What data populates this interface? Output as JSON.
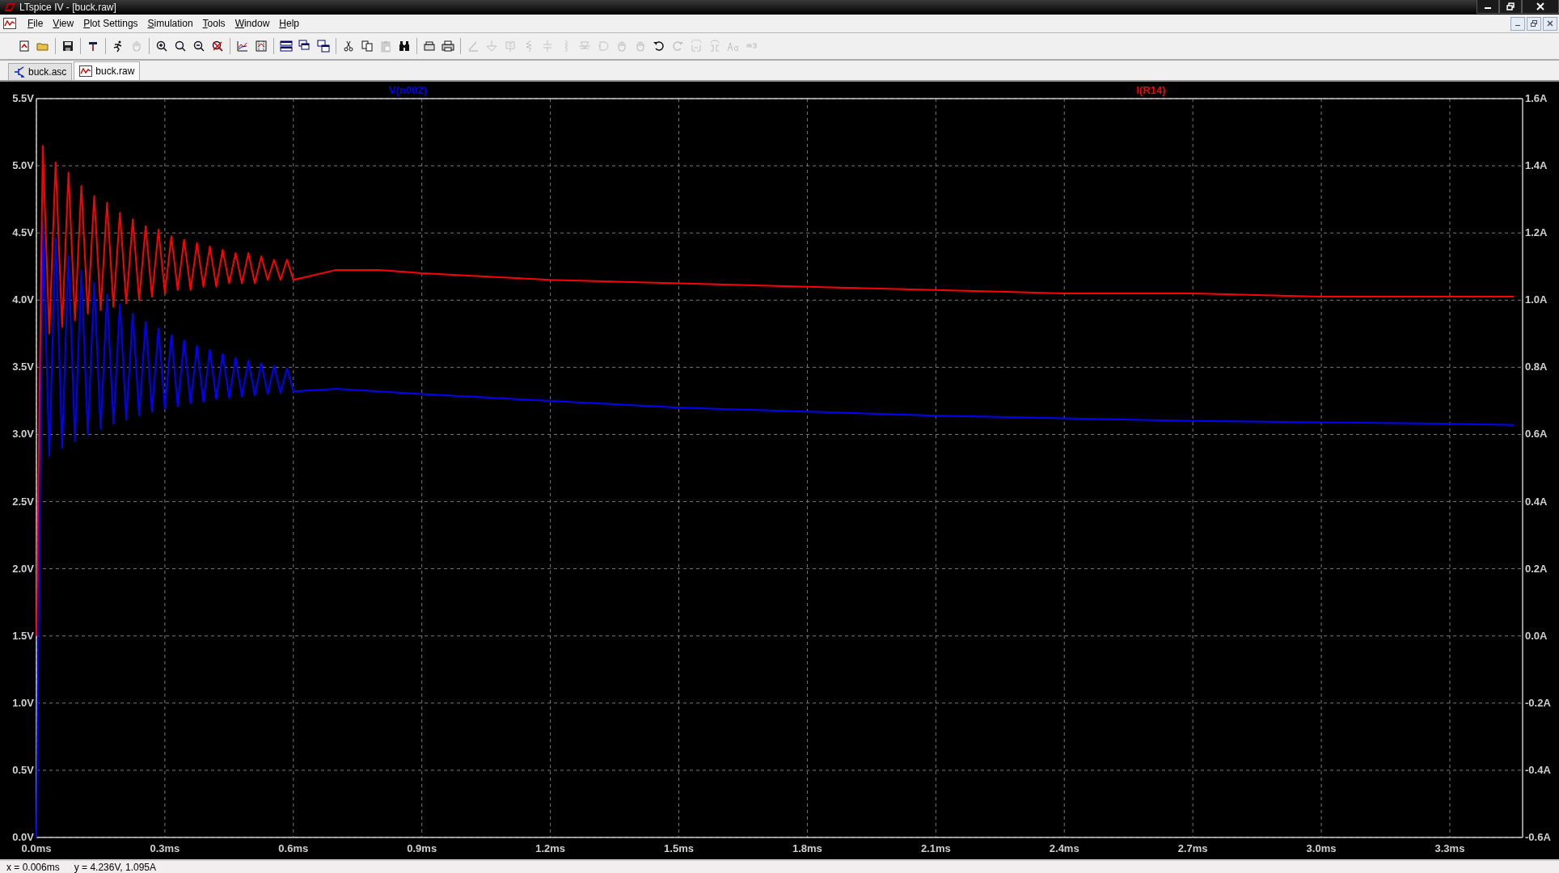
{
  "window": {
    "title": "LTspice IV - [buck.raw]"
  },
  "menu": [
    "File",
    "View",
    "Plot Settings",
    "Simulation",
    "Tools",
    "Window",
    "Help"
  ],
  "toolbar": [
    {
      "kind": "new-document",
      "disabled": false
    },
    {
      "kind": "open-folder",
      "disabled": false
    },
    {
      "kind": "separator"
    },
    {
      "kind": "floppy-save",
      "disabled": false
    },
    {
      "kind": "separator"
    },
    {
      "kind": "hammer",
      "disabled": false
    },
    {
      "kind": "separator"
    },
    {
      "kind": "running-man",
      "disabled": false
    },
    {
      "kind": "hand",
      "disabled": true
    },
    {
      "kind": "separator"
    },
    {
      "kind": "zoom-in",
      "disabled": false
    },
    {
      "kind": "magnifier",
      "disabled": false
    },
    {
      "kind": "zoom-out",
      "disabled": false
    },
    {
      "kind": "zoom-cancel",
      "disabled": false
    },
    {
      "kind": "separator"
    },
    {
      "kind": "autorange",
      "disabled": false
    },
    {
      "kind": "grid-frame",
      "disabled": false
    },
    {
      "kind": "separator"
    },
    {
      "kind": "tile-horizontal",
      "disabled": false
    },
    {
      "kind": "cascade",
      "disabled": false
    },
    {
      "kind": "tile-vertical",
      "disabled": false
    },
    {
      "kind": "separator"
    },
    {
      "kind": "scissors",
      "disabled": false
    },
    {
      "kind": "copy",
      "disabled": false
    },
    {
      "kind": "paste",
      "disabled": true
    },
    {
      "kind": "binoculars",
      "disabled": false
    },
    {
      "kind": "separator"
    },
    {
      "kind": "print-preview",
      "disabled": false
    },
    {
      "kind": "printer",
      "disabled": false
    },
    {
      "kind": "separator"
    },
    {
      "kind": "pencil",
      "disabled": true
    },
    {
      "kind": "ground",
      "disabled": true
    },
    {
      "kind": "label",
      "disabled": true
    },
    {
      "kind": "resistor",
      "disabled": true
    },
    {
      "kind": "capacitor",
      "disabled": true
    },
    {
      "kind": "inductor",
      "disabled": true
    },
    {
      "kind": "diode",
      "disabled": true
    },
    {
      "kind": "gate",
      "disabled": true
    },
    {
      "kind": "hand",
      "disabled": true
    },
    {
      "kind": "hand",
      "disabled": true
    },
    {
      "kind": "undo",
      "disabled": false
    },
    {
      "kind": "redo",
      "disabled": true
    },
    {
      "kind": "rotate",
      "disabled": true
    },
    {
      "kind": "mirror",
      "disabled": true
    },
    {
      "kind": "text-aa",
      "disabled": true
    },
    {
      "kind": "directive",
      "disabled": true
    }
  ],
  "tabs": [
    {
      "label": "buck.asc",
      "kind": "schematic",
      "selected": false
    },
    {
      "label": "buck.raw",
      "kind": "waveform",
      "selected": true
    }
  ],
  "plot": {
    "chart_data": {
      "type": "line",
      "grid": true,
      "x": [
        0,
        0.015,
        0.03,
        0.045,
        0.06,
        0.075,
        0.09,
        0.105,
        0.12,
        0.135,
        0.15,
        0.165,
        0.18,
        0.195,
        0.21,
        0.225,
        0.24,
        0.255,
        0.27,
        0.285,
        0.3,
        0.315,
        0.33,
        0.345,
        0.36,
        0.375,
        0.39,
        0.405,
        0.42,
        0.435,
        0.45,
        0.465,
        0.48,
        0.495,
        0.51,
        0.525,
        0.54,
        0.555,
        0.57,
        0.585,
        0.6,
        0.7,
        0.8,
        0.9,
        1.2,
        1.5,
        1.8,
        2.1,
        2.4,
        2.7,
        3.0,
        3.3,
        3.45
      ],
      "xlim": [
        0,
        3.47
      ],
      "xticks": [
        {
          "value": 0,
          "label": "0.0ms"
        },
        {
          "value": 0.3,
          "label": "0.3ms"
        },
        {
          "value": 0.6,
          "label": "0.6ms"
        },
        {
          "value": 0.9,
          "label": "0.9ms"
        },
        {
          "value": 1.2,
          "label": "1.2ms"
        },
        {
          "value": 1.5,
          "label": "1.5ms"
        },
        {
          "value": 1.8,
          "label": "1.8ms"
        },
        {
          "value": 2.1,
          "label": "2.1ms"
        },
        {
          "value": 2.4,
          "label": "2.4ms"
        },
        {
          "value": 2.7,
          "label": "2.7ms"
        },
        {
          "value": 3.0,
          "label": "3.0ms"
        },
        {
          "value": 3.3,
          "label": "3.3ms"
        }
      ],
      "ylim": [
        0,
        5.5
      ],
      "yticks": [
        {
          "value": 0,
          "label": "0.0V"
        },
        {
          "value": 0.5,
          "label": "0.5V"
        },
        {
          "value": 1,
          "label": "1.0V"
        },
        {
          "value": 1.5,
          "label": "1.5V"
        },
        {
          "value": 2,
          "label": "2.0V"
        },
        {
          "value": 2.5,
          "label": "2.5V"
        },
        {
          "value": 3,
          "label": "3.0V"
        },
        {
          "value": 3.5,
          "label": "3.5V"
        },
        {
          "value": 4,
          "label": "4.0V"
        },
        {
          "value": 4.5,
          "label": "4.5V"
        },
        {
          "value": 5,
          "label": "5.0V"
        },
        {
          "value": 5.5,
          "label": "5.5V"
        }
      ],
      "y2lim": [
        -0.6,
        1.6
      ],
      "y2ticks": [
        {
          "value": -0.6,
          "label": "-0.6A"
        },
        {
          "value": -0.4,
          "label": "-0.4A"
        },
        {
          "value": -0.2,
          "label": "-0.2A"
        },
        {
          "value": 0,
          "label": "0.0A"
        },
        {
          "value": 0.2,
          "label": "0.2A"
        },
        {
          "value": 0.4,
          "label": "0.4A"
        },
        {
          "value": 0.6,
          "label": "0.6A"
        },
        {
          "value": 0.8,
          "label": "0.8A"
        },
        {
          "value": 1.0,
          "label": "1.0A"
        },
        {
          "value": 1.2,
          "label": "1.2A"
        },
        {
          "value": 1.4,
          "label": "1.4A"
        },
        {
          "value": 1.6,
          "label": "1.6A"
        }
      ],
      "series": [
        {
          "name": "V(n002)",
          "color": "#0000ff",
          "values": [
            0,
            4.59,
            2.84,
            4.46,
            2.9,
            4.33,
            2.95,
            4.22,
            3.0,
            4.13,
            3.04,
            4.04,
            3.08,
            3.97,
            3.11,
            3.9,
            3.14,
            3.84,
            3.17,
            3.79,
            3.19,
            3.74,
            3.21,
            3.7,
            3.23,
            3.66,
            3.24,
            3.63,
            3.26,
            3.6,
            3.27,
            3.57,
            3.28,
            3.55,
            3.29,
            3.53,
            3.3,
            3.51,
            3.31,
            3.49,
            3.32,
            3.34,
            3.32,
            3.3,
            3.25,
            3.2,
            3.17,
            3.14,
            3.12,
            3.1,
            3.09,
            3.08,
            3.07
          ]
        },
        {
          "name": "I(R14)",
          "color": "#ff0000",
          "axis": "y2",
          "values": [
            0,
            1.46,
            0.9,
            1.41,
            0.92,
            1.38,
            0.94,
            1.34,
            0.96,
            1.31,
            0.97,
            1.29,
            0.98,
            1.26,
            0.99,
            1.24,
            1.0,
            1.22,
            1.01,
            1.21,
            1.02,
            1.19,
            1.03,
            1.18,
            1.03,
            1.17,
            1.04,
            1.16,
            1.04,
            1.15,
            1.05,
            1.14,
            1.05,
            1.14,
            1.05,
            1.13,
            1.06,
            1.12,
            1.06,
            1.12,
            1.06,
            1.09,
            1.09,
            1.08,
            1.06,
            1.05,
            1.04,
            1.03,
            1.02,
            1.02,
            1.01,
            1.01,
            1.01
          ]
        }
      ]
    }
  },
  "status_bar": {
    "cursor_x": "x = 0.006ms",
    "cursor_y": "y = 4.236V, 1.095A"
  }
}
